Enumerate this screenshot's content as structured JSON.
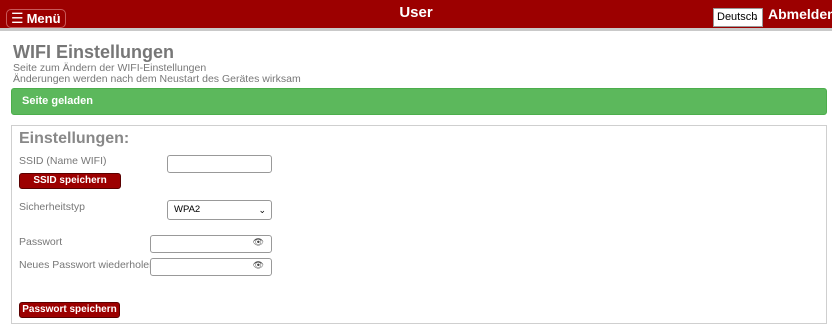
{
  "header": {
    "menu_icon": "hamburger-icon",
    "menu_label": "Menü",
    "title": "User",
    "language": "Deutsch",
    "logout_label": "Abmelden",
    "bar_color": "#9c0000"
  },
  "page": {
    "title": "WIFI Einstellungen",
    "subtitle_line1": "Seite zum Ändern der WIFI-Einstellungen",
    "subtitle_line2": "Änderungen werden nach dem Neustart des Gerätes wirksam"
  },
  "status": {
    "text": "Seite geladen",
    "color": "#5cb85c"
  },
  "settings": {
    "title": "Einstellungen:",
    "ssid_label": "SSID (Name WIFI)",
    "ssid_value": "",
    "ssid_save": "SSID speichern",
    "security_label": "Sicherheitstyp",
    "security_value": "WPA2",
    "password_label": "Passwort",
    "password_repeat_label": "Neues Passwort wiederholen",
    "password_save": "Passwort speichern"
  }
}
